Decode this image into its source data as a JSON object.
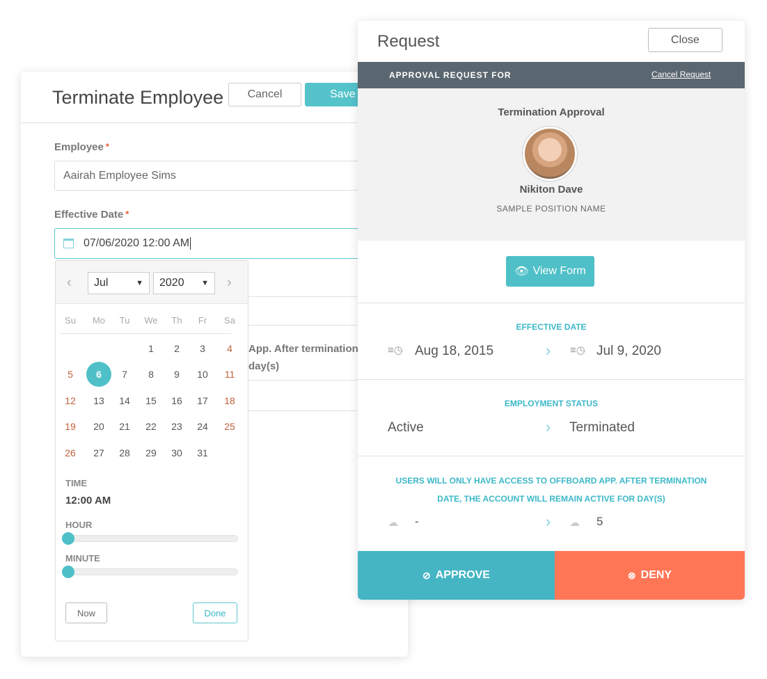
{
  "terminate_form": {
    "title": "Terminate Employee",
    "cancel_label": "Cancel",
    "save_label": "Save",
    "employee_label": "Employee",
    "employee_value": "Aairah Employee Sims",
    "effective_date_label": "Effective Date",
    "effective_date_value": "07/06/2020 12:00 AM",
    "required_mark": "*",
    "hidden_text_line1": "App. After termination",
    "hidden_text_line2": "day(s)"
  },
  "datepicker": {
    "month": "Jul",
    "year": "2020",
    "weekdays": [
      "Su",
      "Mo",
      "Tu",
      "We",
      "Th",
      "Fr",
      "Sa"
    ],
    "weeks": [
      [
        "",
        "",
        "",
        "1",
        "2",
        "3",
        "4"
      ],
      [
        "5",
        "6",
        "7",
        "8",
        "9",
        "10",
        "11"
      ],
      [
        "12",
        "13",
        "14",
        "15",
        "16",
        "17",
        "18"
      ],
      [
        "19",
        "20",
        "21",
        "22",
        "23",
        "24",
        "25"
      ],
      [
        "26",
        "27",
        "28",
        "29",
        "30",
        "31",
        ""
      ]
    ],
    "selected_day": "6",
    "time_label": "TIME",
    "time_value": "12:00 AM",
    "hour_label": "HOUR",
    "hour_value": 0,
    "minute_label": "MINUTE",
    "minute_value": 0,
    "now_label": "Now",
    "done_label": "Done"
  },
  "request": {
    "title": "Request",
    "close_label": "Close",
    "bar_label": "APPROVAL REQUEST FOR",
    "cancel_request": "Cancel Request",
    "approval_type": "Termination Approval",
    "name": "Nikiton Dave",
    "position": "SAMPLE POSITION NAME",
    "view_form": "View Form",
    "effective_date": {
      "label": "EFFECTIVE DATE",
      "from": "Aug 18, 2015",
      "to": "Jul 9, 2020"
    },
    "employment_status": {
      "label": "EMPLOYMENT STATUS",
      "from": "Active",
      "to": "Terminated"
    },
    "access": {
      "label_line1": "USERS WILL ONLY HAVE ACCESS TO OFFBOARD APP. AFTER TERMINATION",
      "label_line2": "DATE, THE ACCOUNT WILL REMAIN ACTIVE FOR DAY(S)",
      "from": "-",
      "to": "5"
    },
    "approve_label": "APPROVE",
    "deny_label": "DENY"
  },
  "colors": {
    "teal": "#4fc0c8",
    "dark_bar": "#5b6770",
    "approve": "#45b5c4",
    "deny": "#ff7657",
    "weekend": "#c0613a"
  }
}
